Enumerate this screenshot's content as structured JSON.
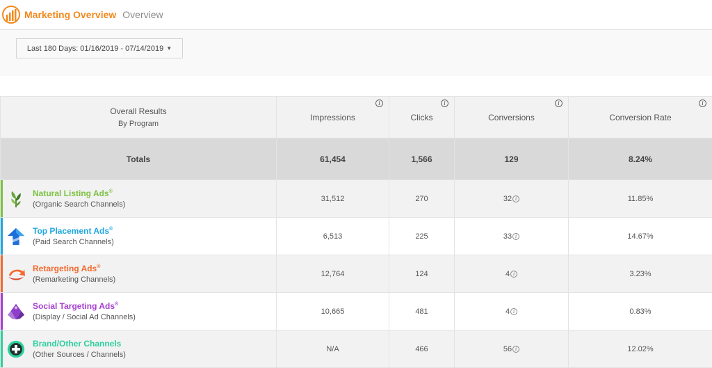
{
  "header": {
    "app_title": "Marketing Overview",
    "breadcrumb": "Overview"
  },
  "filter": {
    "date_range": "Last 180 Days: 01/16/2019 - 07/14/2019",
    "caret": "▼"
  },
  "table": {
    "col1_title": "Overall Results",
    "col1_sub": "By Program",
    "columns": [
      "Impressions",
      "Clicks",
      "Conversions",
      "Conversion Rate"
    ],
    "info_glyph": "i",
    "totals": {
      "label": "Totals",
      "impressions": "61,454",
      "clicks": "1,566",
      "conversions": "129",
      "rate": "8.24%"
    },
    "rows": [
      {
        "name": "Natural Listing Ads",
        "mark": "®",
        "sub": "(Organic Search Channels)",
        "impressions": "31,512",
        "clicks": "270",
        "conversions": "32",
        "rate": "11.85%",
        "color": "#7cc242",
        "icon": "sprout-icon"
      },
      {
        "name": "Top Placement Ads",
        "mark": "®",
        "sub": "(Paid Search Channels)",
        "impressions": "6,513",
        "clicks": "225",
        "conversions": "33",
        "rate": "14.67%",
        "color": "#1ea7e1",
        "icon": "arrow-up-icon"
      },
      {
        "name": "Retargeting Ads",
        "mark": "®",
        "sub": "(Remarketing Channels)",
        "impressions": "12,764",
        "clicks": "124",
        "conversions": "4",
        "rate": "3.23%",
        "color": "#f26a2e",
        "icon": "retarget-swoosh-icon"
      },
      {
        "name": "Social Targeting Ads",
        "mark": "®",
        "sub": "(Display / Social Ad Channels)",
        "impressions": "10,665",
        "clicks": "481",
        "conversions": "4",
        "rate": "0.83%",
        "color": "#a63fd1",
        "icon": "social-diamond-icon"
      },
      {
        "name": "Brand/Other Channels",
        "mark": "",
        "sub": "(Other Sources / Channels)",
        "impressions": "N/A",
        "clicks": "466",
        "conversions": "56",
        "rate": "12.02%",
        "color": "#2fcf9e",
        "icon": "plus-circle-icon"
      }
    ]
  }
}
